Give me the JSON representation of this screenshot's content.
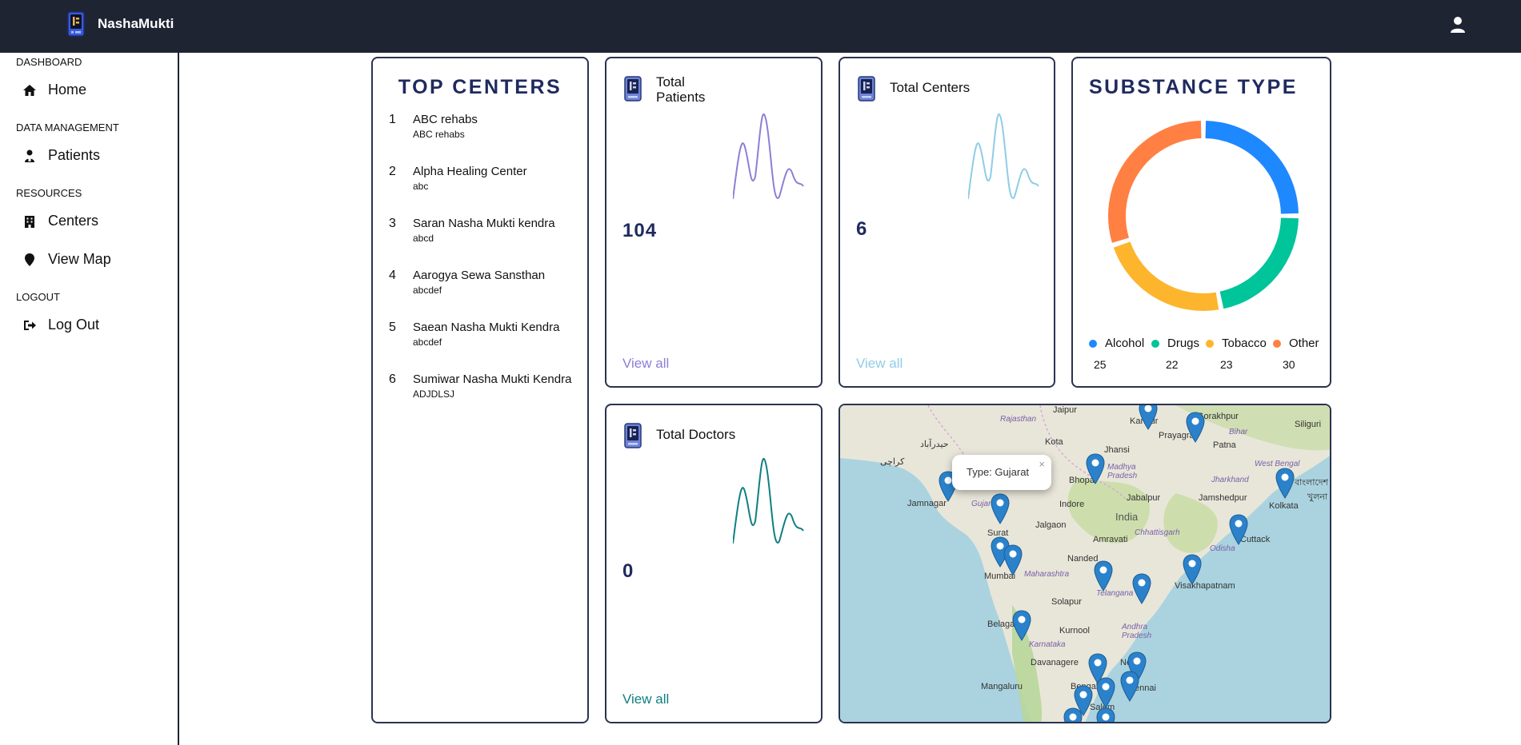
{
  "app": {
    "name": "NashaMukti"
  },
  "sidebar": {
    "sections": [
      {
        "title": "DASHBOARD",
        "items": [
          {
            "label": "Home",
            "icon": "home-icon"
          }
        ]
      },
      {
        "title": "DATA MANAGEMENT",
        "items": [
          {
            "label": "Patients",
            "icon": "patient-icon"
          }
        ]
      },
      {
        "title": "RESOURCES",
        "items": [
          {
            "label": "Centers",
            "icon": "building-icon"
          },
          {
            "label": "View Map",
            "icon": "map-pin-icon"
          }
        ]
      },
      {
        "title": "LOGOUT",
        "items": [
          {
            "label": "Log Out",
            "icon": "logout-icon"
          }
        ]
      }
    ]
  },
  "top_centers": {
    "title": "TOP CENTERS",
    "items": [
      {
        "rank": "1",
        "name": "ABC rehabs",
        "sub": "ABC rehabs"
      },
      {
        "rank": "2",
        "name": "Alpha Healing Center",
        "sub": "abc"
      },
      {
        "rank": "3",
        "name": "Saran Nasha Mukti kendra",
        "sub": "abcd"
      },
      {
        "rank": "4",
        "name": "Aarogya Sewa Sansthan",
        "sub": "abcdef"
      },
      {
        "rank": "5",
        "name": "Saean Nasha Mukti Kendra",
        "sub": "abcdef"
      },
      {
        "rank": "6",
        "name": "Sumiwar Nasha Mukti Kendra",
        "sub": "ADJDLSJ"
      }
    ]
  },
  "stats": {
    "patients": {
      "label": "Total Patients",
      "value": "104",
      "link": "View all",
      "color": "#8b7fd6"
    },
    "centers": {
      "label": "Total Centers",
      "value": "6",
      "link": "View all",
      "color": "#8ecde6"
    },
    "doctors": {
      "label": "Total Doctors",
      "value": "0",
      "link": "View all",
      "color": "#0f7f80"
    }
  },
  "substance": {
    "title": "SUBSTANCE TYPE",
    "segments": [
      {
        "label": "Alcohol",
        "value": 25,
        "color": "#1e88ff"
      },
      {
        "label": "Drugs",
        "value": 22,
        "color": "#00c49a"
      },
      {
        "label": "Tobacco",
        "value": 23,
        "color": "#fdb52e"
      },
      {
        "label": "Other",
        "value": 30,
        "color": "#ff8042"
      }
    ]
  },
  "map": {
    "popup_text": "Type: Gujarat",
    "close_glyph": "×",
    "country_label": "India",
    "city_labels": [
      "Jaipur",
      "Kanpur",
      "Gorakhpur",
      "Siliguri",
      "Prayagraj",
      "Patna",
      "Kota",
      "Jhansi",
      "حیدرآباد",
      "کراچی",
      "Bhopal",
      "Jamnagar",
      "Indore",
      "Jabalpur",
      "Jamshedpur",
      "Kolkata",
      "খুলনা",
      "বাংলাদেশ",
      "Surat",
      "Jalgaon",
      "Amravati",
      "Cuttack",
      "Mumbai",
      "Nanded",
      "Visakhapatnam",
      "Solapur",
      "Belagavi",
      "Kurnool",
      "Davanagere",
      "Mangaluru",
      "Chennai",
      "Salem",
      "Bengaluru",
      "Ne"
    ],
    "state_labels": [
      "Rajasthan",
      "Bihar",
      "West Bengal",
      "Jharkhand",
      "Madhya Pradesh",
      "Gujarat",
      "Chhattisgarh",
      "Odisha",
      "Maharashtra",
      "Telangana",
      "Andhra Pradesh",
      "Karnataka"
    ]
  }
}
